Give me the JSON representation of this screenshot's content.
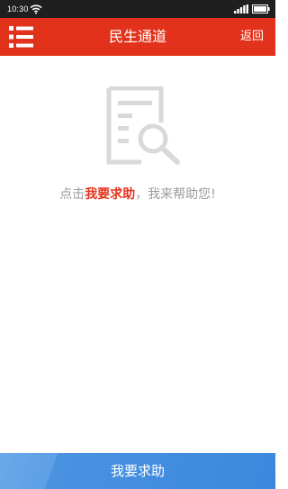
{
  "status_bar": {
    "time": "10:30"
  },
  "header": {
    "title": "民生通道",
    "back_label": "返回",
    "menu_icon": "menu-list-icon"
  },
  "empty_state": {
    "icon": "document-search-icon",
    "message_prefix": "点击",
    "message_link": "我要求助",
    "message_suffix": "，我来帮助您!"
  },
  "footer": {
    "help_button_label": "我要求助"
  },
  "colors": {
    "header_bg": "#e3321c",
    "accent_red": "#e3321c",
    "button_blue": "#3a88de",
    "muted_text": "#9a9a9a",
    "status_bar_bg": "#1f1f1f"
  }
}
